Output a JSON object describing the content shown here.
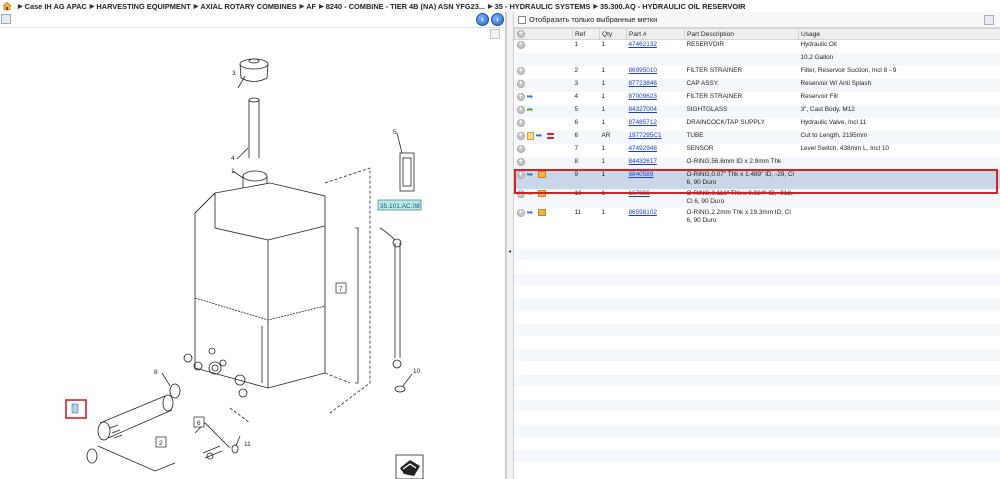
{
  "breadcrumb": {
    "items": [
      "Case IH AG APAC",
      "HARVESTING EQUIPMENT",
      "AXIAL ROTARY COMBINES",
      "AF",
      "8240 - COMBINE - TIER 4B (NA) ASN YFG23...",
      "35 - HYDRAULIC SYSTEMS",
      "35.300.AQ - HYDRAULIC OIL RESERVOIR"
    ]
  },
  "diagram": {
    "callouts": [
      "1",
      "2",
      "3",
      "4",
      "5",
      "6",
      "7",
      "8",
      "10",
      "11"
    ],
    "ref_code": "35.101.AC.08"
  },
  "parts_panel": {
    "show_selected_label": "Отобразить только выбранные метки",
    "columns": [
      "",
      "Ref",
      "Qty",
      "Part #",
      "Part Description",
      "Usage"
    ],
    "rows": [
      {
        "ref": "1",
        "qty": "1",
        "part": "47462132",
        "desc": "RESERVOIR",
        "usage": "Hydraulic Oil",
        "icons": []
      },
      {
        "ref": "",
        "qty": "",
        "part": "",
        "desc": "",
        "usage": "10.2 Gallon",
        "icons": [],
        "continuation": true
      },
      {
        "ref": "2",
        "qty": "1",
        "part": "86995010",
        "desc": "FILTER STRAINER",
        "usage": "Filter, Reservoir Suction, Incl 8 - 9",
        "icons": []
      },
      {
        "ref": "3",
        "qty": "1",
        "part": "87723846",
        "desc": "CAP ASSY.",
        "usage": "Reservoir W/ Anti Splash",
        "icons": []
      },
      {
        "ref": "4",
        "qty": "1",
        "part": "87009623",
        "desc": "FILTER STRAINER",
        "usage": "Reservoir Fill",
        "icons": [
          "arrow-blue"
        ]
      },
      {
        "ref": "5",
        "qty": "1",
        "part": "84327004",
        "desc": "SIGHTGLASS",
        "usage": "3\", Cast Body, M12",
        "icons": [
          "arrow-green"
        ]
      },
      {
        "ref": "6",
        "qty": "1",
        "part": "87485712",
        "desc": "DRAINCOCK/TAP SUPPLY",
        "usage": "Hydraulic Valve, Incl 11",
        "icons": []
      },
      {
        "ref": "6",
        "qty": "AR",
        "part": "1977295C1",
        "desc": "TUBE",
        "usage": "Cut to Length, 2195mm",
        "icons": [
          "note",
          "arrow-blue",
          "red"
        ]
      },
      {
        "ref": "7",
        "qty": "1",
        "part": "47492948",
        "desc": "SENSOR",
        "usage": "Level Switch, 438mm L, Incl 10",
        "icons": []
      },
      {
        "ref": "8",
        "qty": "1",
        "part": "84432617",
        "desc": "O-RING,56.6mm ID x 2.9mm Thk",
        "usage": "",
        "icons": []
      },
      {
        "ref": "9",
        "qty": "1",
        "part": "9840589",
        "desc": "O-RING,0.07\" Thk x 1.489\" ID, -29, Cl 6, 90 Duro",
        "usage": "",
        "icons": [
          "arrow-blue",
          "box"
        ],
        "selected": true
      },
      {
        "ref": "10",
        "qty": "1",
        "part": "167266",
        "desc": "O-RING,0.116\" Thk x 0.924\" ID, -912, Cl 6, 90 Duro",
        "usage": "",
        "icons": [
          "arrow-blue",
          "box"
        ]
      },
      {
        "ref": "11",
        "qty": "1",
        "part": "86598102",
        "desc": "O-RING,2.2mm Thk x 19.3mm ID, Cl 6, 90 Duro",
        "usage": "",
        "icons": [
          "arrow-blue",
          "box"
        ]
      }
    ]
  }
}
